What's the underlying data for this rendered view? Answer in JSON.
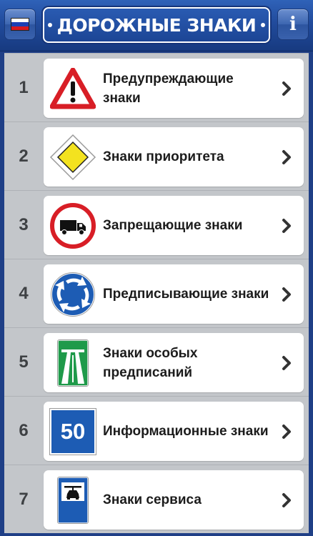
{
  "header": {
    "title": "ДОРОЖНЫЕ ЗНАКИ",
    "info_button_label": "i",
    "flag_colors": [
      "#ffffff",
      "#1c3fb5",
      "#d71920"
    ]
  },
  "categories": [
    {
      "number": "1",
      "label": "Предупреждающие знаки",
      "icon": "warning-sign-icon"
    },
    {
      "number": "2",
      "label": "Знаки приоритета",
      "icon": "priority-road-sign-icon"
    },
    {
      "number": "3",
      "label": "Запрещающие знаки",
      "icon": "no-trucks-sign-icon"
    },
    {
      "number": "4",
      "label": "Предписывающие знаки",
      "icon": "roundabout-sign-icon"
    },
    {
      "number": "5",
      "label": "Знаки особых предписаний",
      "icon": "motorway-sign-icon"
    },
    {
      "number": "6",
      "label": "Информационные знаки",
      "icon": "speed-50-sign-icon",
      "icon_text": "50"
    },
    {
      "number": "7",
      "label": "Знаки сервиса",
      "icon": "car-service-sign-icon"
    }
  ]
}
